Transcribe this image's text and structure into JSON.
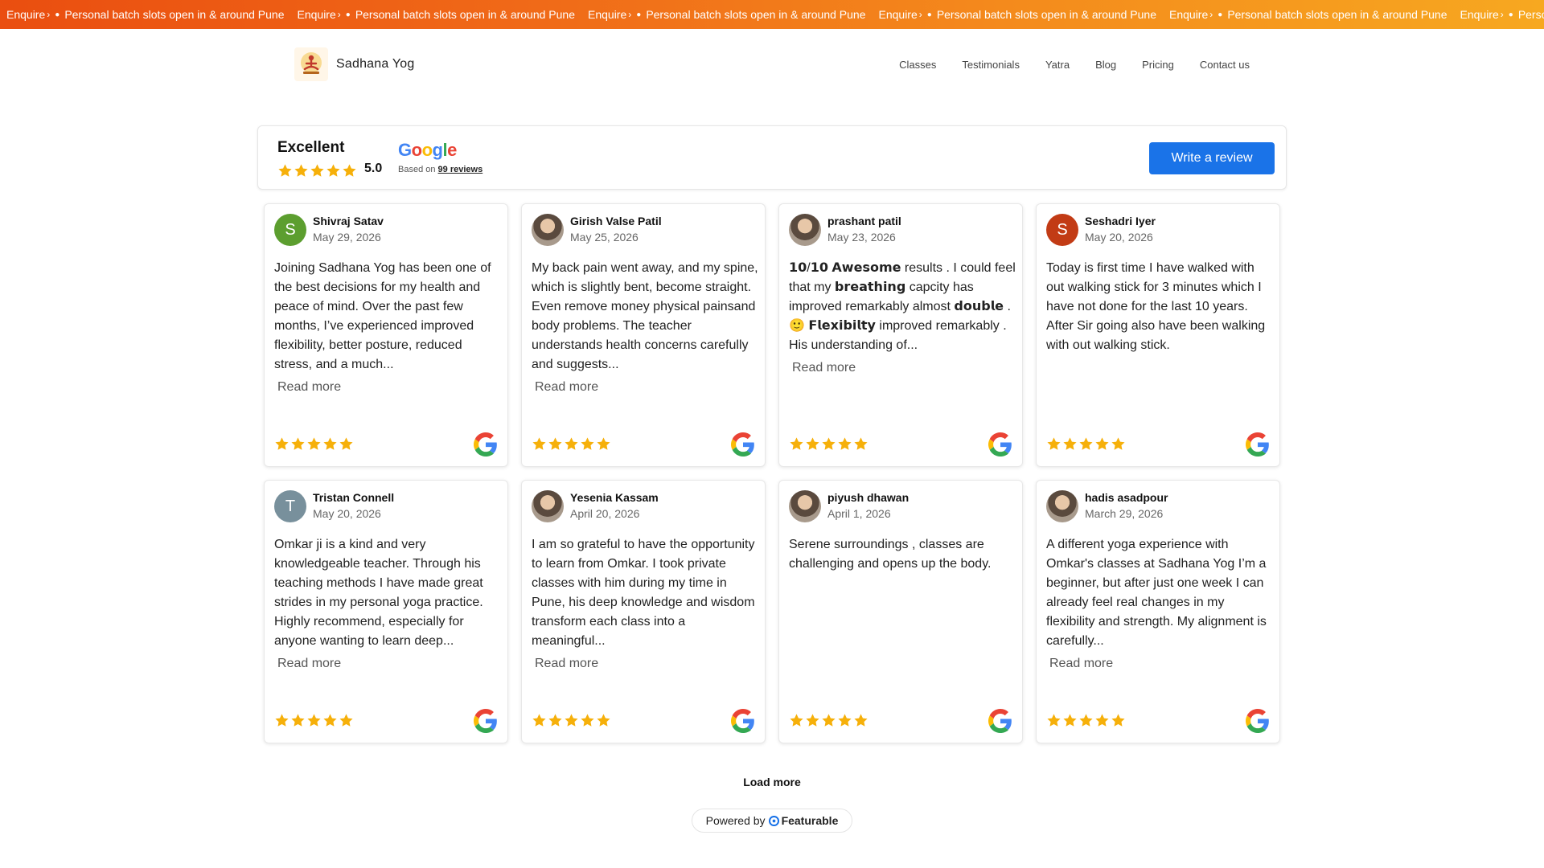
{
  "banner": {
    "message": "Personal batch slots open in & around Pune",
    "cta": "Enquire"
  },
  "header": {
    "brand": "Sadhana Yog",
    "nav": [
      "Classes",
      "Testimonials",
      "Yatra",
      "Blog",
      "Pricing",
      "Contact us"
    ]
  },
  "summary": {
    "title": "Excellent",
    "rating": "5.0",
    "google": "Google",
    "based_prefix": "Based on",
    "based_count": "99 reviews",
    "write_review": "Write a review"
  },
  "reviews": [
    {
      "name": "Shivraj Satav",
      "date": "May 29, 2026",
      "initial": "S",
      "avatar_color": "#5c9e2f",
      "photo": false,
      "stars": 5,
      "text": "Joining Sadhana Yog has been one of the best decisions for my health and peace of mind. Over the past few months, I’ve experienced improved flexibility, better posture, reduced stress, and a much...",
      "read_more": "Read more"
    },
    {
      "name": "Girish Valse Patil",
      "date": "May 25, 2026",
      "initial": "",
      "avatar_color": "#6b5a4a",
      "photo": true,
      "stars": 5,
      "text": "My back pain went away, and my spine, which is slightly bent, become straight. Even remove money physical painsand body problems. The teacher understands health concerns carefully and suggests...",
      "read_more": "Read more"
    },
    {
      "name": "prashant patil",
      "date": "May 23, 2026",
      "initial": "",
      "avatar_color": "#3a3a3a",
      "photo": true,
      "stars": 5,
      "text": "𝟭𝟬/𝟭𝟬 𝗔𝘄𝗲𝘀𝗼𝗺𝗲 results . I could feel that my 𝗯𝗿𝗲𝗮𝘁𝗵𝗶𝗻𝗴 capcity has improved remarkably almost 𝗱𝗼𝘂𝗯𝗹𝗲 .🙂 𝗙𝗹𝗲𝘅𝗶𝗯𝗶𝗹𝘁𝘆 improved remarkably . His understanding of...",
      "read_more": "Read more"
    },
    {
      "name": "Seshadri Iyer",
      "date": "May 20, 2026",
      "initial": "S",
      "avatar_color": "#c23b15",
      "photo": false,
      "stars": 5,
      "text": "Today is first time I have walked with out walking stick for 3 minutes which I have not done for the last 10 years. After Sir going also have been walking with out walking stick.",
      "read_more": ""
    },
    {
      "name": "Tristan Connell",
      "date": "May 20, 2026",
      "initial": "T",
      "avatar_color": "#78909c",
      "photo": false,
      "stars": 5,
      "text": "Omkar ji is a kind and very knowledgeable teacher. Through his teaching methods I have made great strides in my personal yoga practice. Highly recommend, especially for anyone wanting to learn deep...",
      "read_more": "Read more"
    },
    {
      "name": "Yesenia Kassam",
      "date": "April 20, 2026",
      "initial": "",
      "avatar_color": "#c98a4a",
      "photo": true,
      "stars": 5,
      "text": "I am so grateful to have the opportunity to learn from Omkar. I took private classes with him during my time in Pune, his deep knowledge and wisdom transform each class into a meaningful...",
      "read_more": "Read more"
    },
    {
      "name": "piyush dhawan",
      "date": "April 1, 2026",
      "initial": "",
      "avatar_color": "#5a5a5a",
      "photo": true,
      "stars": 5,
      "text": "Serene surroundings , classes are challenging and opens up the body.",
      "read_more": ""
    },
    {
      "name": "hadis asadpour",
      "date": "March 29, 2026",
      "initial": "",
      "avatar_color": "#8a6a5a",
      "photo": true,
      "stars": 5,
      "text": "A different yoga experience with Omkar's classes at Sadhana Yog I’m a beginner, but after just one week I can already feel real changes in my flexibility and strength. My alignment is carefully...",
      "read_more": "Read more"
    }
  ],
  "load_more": "Load more",
  "powered_by": "Powered by",
  "powered_brand": "Featurable",
  "colors": {
    "star": "#f6b00a",
    "google_blue": "#1a73e8",
    "banner_start": "#ea4e10",
    "banner_end": "#f7a820"
  }
}
